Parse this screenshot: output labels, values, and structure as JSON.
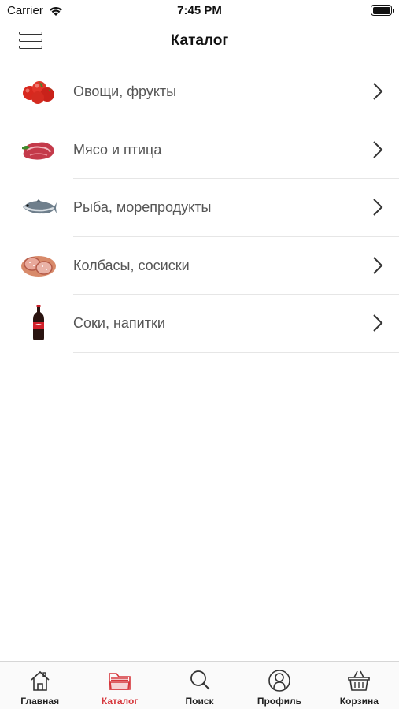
{
  "status_bar": {
    "carrier": "Carrier",
    "time": "7:45 PM"
  },
  "nav": {
    "title": "Каталог",
    "menu_icon": "hamburger-menu-icon"
  },
  "categories": [
    {
      "label": "Овощи, фрукты",
      "icon": "tomatoes-image"
    },
    {
      "label": "Мясо и птица",
      "icon": "meat-image"
    },
    {
      "label": "Рыба, морепродукты",
      "icon": "fish-image"
    },
    {
      "label": "Колбасы, сосиски",
      "icon": "sausage-image"
    },
    {
      "label": "Соки, напитки",
      "icon": "soda-bottle-image"
    }
  ],
  "tabs": [
    {
      "label": "Главная",
      "icon": "home-icon",
      "active": false
    },
    {
      "label": "Каталог",
      "icon": "folder-icon",
      "active": true
    },
    {
      "label": "Поиск",
      "icon": "search-icon",
      "active": false
    },
    {
      "label": "Профиль",
      "icon": "profile-icon",
      "active": false
    },
    {
      "label": "Корзина",
      "icon": "basket-icon",
      "active": false
    }
  ],
  "colors": {
    "accent": "#d6373c",
    "text": "#555555",
    "separator": "#e6e6e6"
  }
}
